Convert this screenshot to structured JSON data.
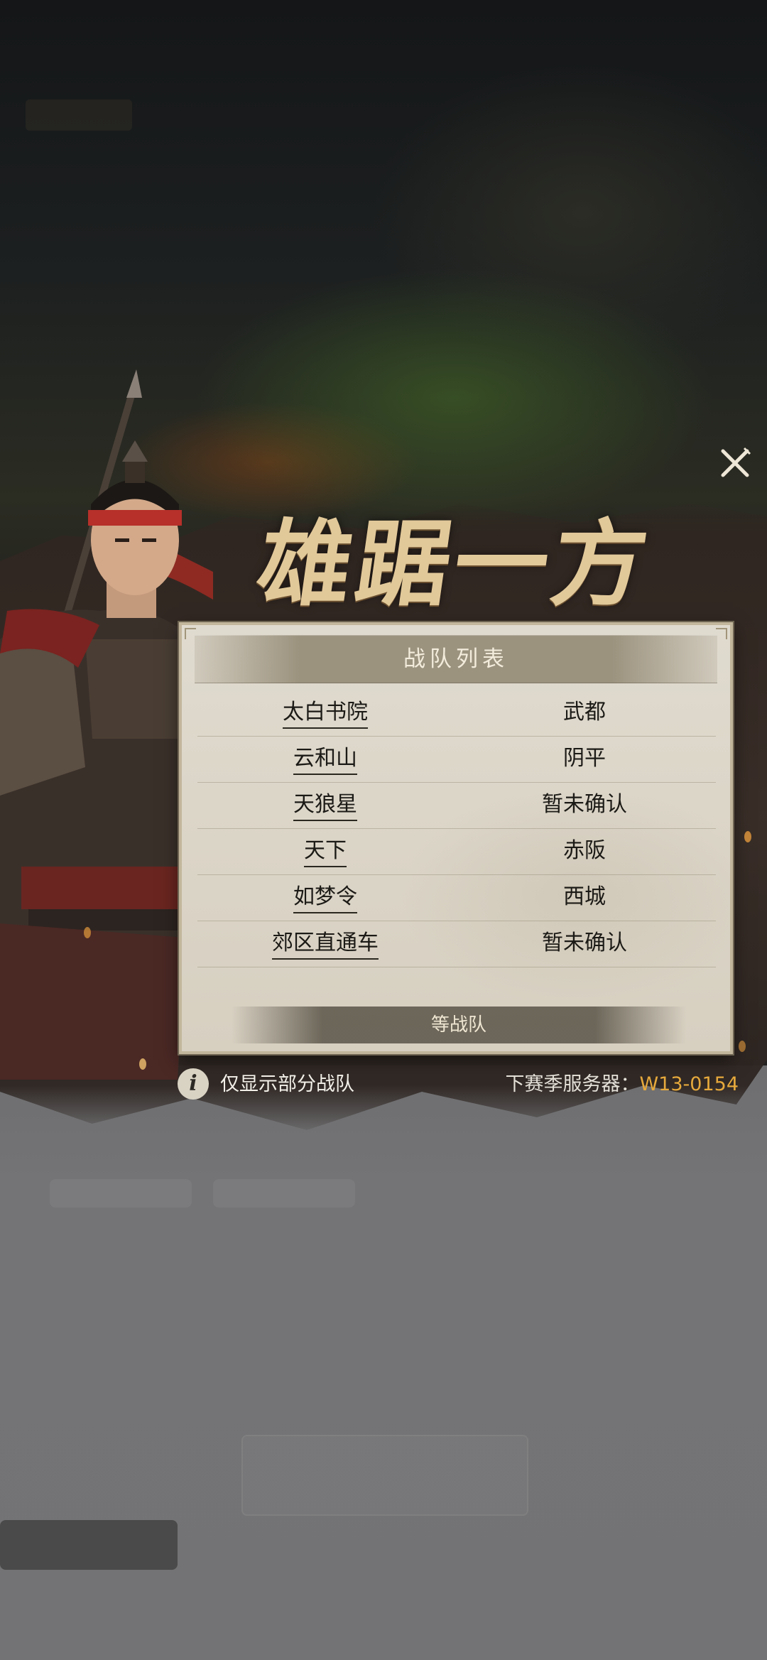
{
  "title": "雄踞一方",
  "panel": {
    "header": "战队列表",
    "footer": "等战队",
    "teams": [
      {
        "name": "太白书院",
        "server": "武都"
      },
      {
        "name": "云和山",
        "server": "阴平"
      },
      {
        "name": "天狼星",
        "server": "暂未确认"
      },
      {
        "name": "天下",
        "server": "赤阪"
      },
      {
        "name": "如梦令",
        "server": "西城"
      },
      {
        "name": "郊区直通车",
        "server": "暂未确认"
      }
    ]
  },
  "info": {
    "icon": "info-icon",
    "text": "仅显示部分战队",
    "next_season_label": "下赛季服务器：",
    "next_season_server": "W13-0154"
  },
  "close_icon": "close-icon",
  "colors": {
    "accent": "#e6a93c",
    "title": "#e2c99a",
    "panel_bg": "#dcd6c9"
  }
}
